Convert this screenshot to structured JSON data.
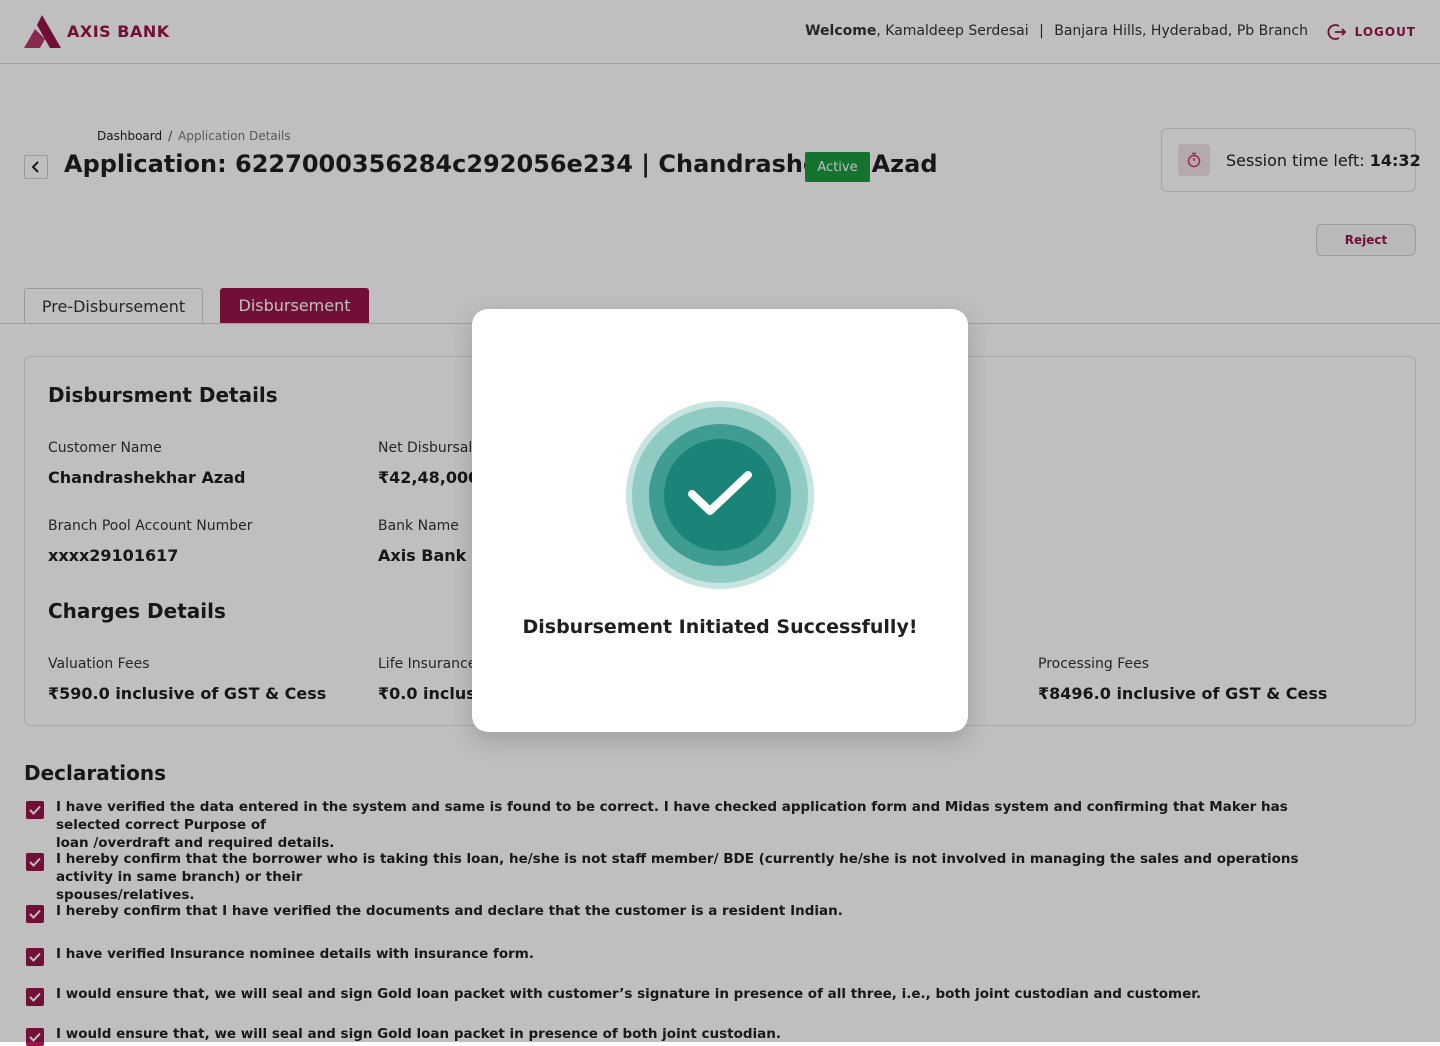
{
  "brand": {
    "name": "AXIS BANK",
    "color": "#97144d"
  },
  "header": {
    "welcome_prefix": "Welcome",
    "welcome_user": ", Kamaldeep Serdesai",
    "separator": "|",
    "branch": "Banjara Hills, Hyderabad, Pb Branch",
    "logout_label": "LOGOUT",
    "logout_icon": "logout-icon"
  },
  "breadcrumb": {
    "items": [
      "Dashboard",
      "Application Details"
    ],
    "separator": "/"
  },
  "page": {
    "title": "Application: 6227000356284c292056e234  |  Chandrashekar Azad",
    "status": "Active",
    "status_color": "#1b9a3e"
  },
  "session": {
    "label": "Session time left:",
    "time": "14:32",
    "icon": "timer-icon"
  },
  "actions": {
    "reject_label": "Reject"
  },
  "tabs": [
    {
      "label": "Pre-Disbursement",
      "active": false
    },
    {
      "label": "Disbursement",
      "active": true
    }
  ],
  "disbursement": {
    "title": "Disbursment Details",
    "fields": [
      {
        "label": "Customer Name",
        "value": "Chandrashekhar Azad"
      },
      {
        "label": "Net Disbursal A",
        "value": "₹42,48,000"
      },
      {
        "label": "Branch Pool Account Number",
        "value": "xxxx29101617"
      },
      {
        "label": "Bank Name",
        "value": "Axis Bank"
      }
    ]
  },
  "charges": {
    "title": "Charges Details",
    "fields": [
      {
        "label": "Valuation Fees",
        "value": "₹590.0 inclusive of GST & Cess"
      },
      {
        "label": "Life Insurance",
        "value": "₹0.0 inclusive"
      },
      {
        "label": "Processing Fees",
        "value": "₹8496.0 inclusive of GST & Cess"
      }
    ]
  },
  "declarations": {
    "title": "Declarations",
    "items": [
      {
        "checked": true,
        "line1": "I have verified the data entered in the system and same is found to be correct. I have checked application form and Midas system and confirming that Maker has selected correct Purpose of",
        "line2": "loan /overdraft and required details."
      },
      {
        "checked": true,
        "line1": "I hereby confirm that the borrower who is taking this loan, he/she is not staff member/ BDE (currently he/she is not involved in managing the sales and operations activity in same branch) or their",
        "line2": "spouses/relatives."
      },
      {
        "checked": true,
        "line1": "I hereby confirm that I have verified the documents and declare that the customer is a resident Indian.",
        "line2": ""
      },
      {
        "checked": true,
        "line1": "I have verified Insurance nominee details with insurance form.",
        "line2": ""
      },
      {
        "checked": true,
        "line1": "I would ensure that, we will seal and sign Gold loan packet with customer’s signature in presence of all three, i.e., both joint custodian and customer.",
        "line2": ""
      },
      {
        "checked": true,
        "line1": "I would ensure that, we will seal and sign Gold loan packet in presence of both joint custodian.",
        "line2": ""
      }
    ]
  },
  "modal": {
    "message": "Disbursement Initiated Successfully!",
    "icon": "success-check-icon",
    "accent": "#1a8479"
  }
}
